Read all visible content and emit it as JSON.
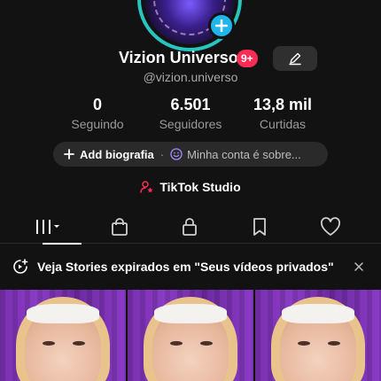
{
  "profile": {
    "name": "Vizion Universo",
    "notification_badge": "9+",
    "handle": "@vizion.universo"
  },
  "stats": [
    {
      "value": "0",
      "label": "Seguindo"
    },
    {
      "value": "6.501",
      "label": "Seguidores"
    },
    {
      "value": "13,8 mil",
      "label": "Curtidas"
    }
  ],
  "bio": {
    "add_label": "Add biografia",
    "separator": "·",
    "note_label": "Minha conta é sobre..."
  },
  "studio": {
    "label": "TikTok Studio"
  },
  "tabs": [
    {
      "icon": "grid-icon",
      "active": true
    },
    {
      "icon": "shopping-bag-icon"
    },
    {
      "icon": "lock-icon"
    },
    {
      "icon": "bookmark-icon"
    },
    {
      "icon": "heart-icon"
    }
  ],
  "banner": {
    "text": "Veja Stories expirados em \"Seus vídeos privados\""
  },
  "colors": {
    "background": "#121212",
    "accent": "#fe2c55",
    "avatar_ring": "#27c4c0",
    "plus_badge": "#1fb6ee"
  }
}
